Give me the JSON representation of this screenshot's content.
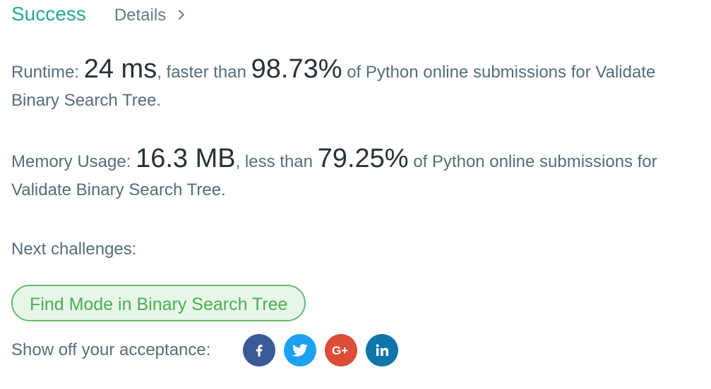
{
  "header": {
    "status": "Success",
    "details_label": "Details"
  },
  "runtime": {
    "label": "Runtime:",
    "value": "24 ms",
    "middle_text": ", faster than",
    "percent": "98.73%",
    "suffix_text": "of Python online submissions for Validate Binary Search Tree."
  },
  "memory": {
    "label": "Memory Usage:",
    "value": "16.3 MB",
    "middle_text": ", less than",
    "percent": "79.25%",
    "suffix_text": "of Python online submissions for Validate Binary Search Tree."
  },
  "next": {
    "label": "Next challenges:",
    "challenges": [
      {
        "label": "Find Mode in Binary Search Tree"
      }
    ]
  },
  "share": {
    "label": "Show off your acceptance:",
    "icons": [
      {
        "name": "facebook-icon",
        "color": "#3b5998"
      },
      {
        "name": "twitter-icon",
        "color": "#1da1f2"
      },
      {
        "name": "google-plus-icon",
        "color": "#dd4b39"
      },
      {
        "name": "linkedin-icon",
        "color": "#0e76a8"
      }
    ]
  },
  "colors": {
    "success": "#26a69a",
    "challenge_border": "#66bb6a",
    "challenge_bg": "#e8f5e9",
    "challenge_text": "#4caf50"
  }
}
